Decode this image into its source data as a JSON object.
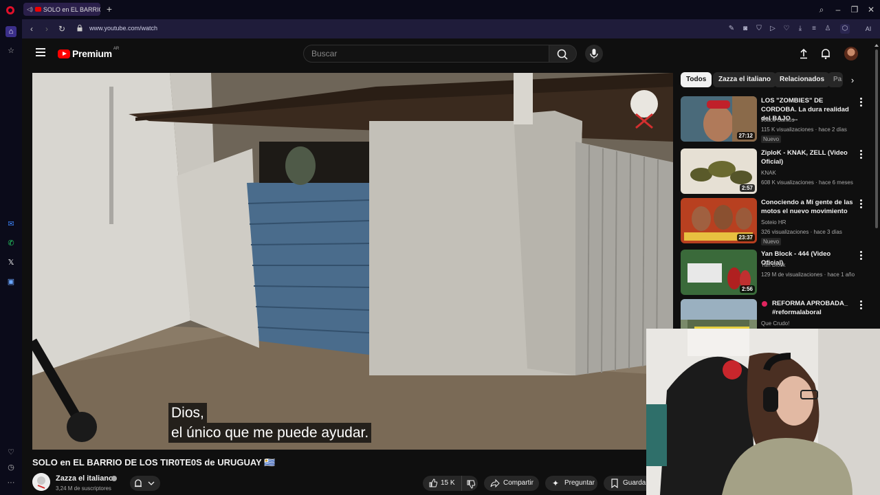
{
  "browser": {
    "tab_title": "SOLO en EL BARRIO D",
    "url": "www.youtube.com/watch",
    "ai_label": "AI"
  },
  "youtube": {
    "logo_text": "Premium",
    "country_code": "AR",
    "search_placeholder": "Buscar"
  },
  "video": {
    "caption_line1": "Dios,",
    "caption_line2": "el único que me puede ayudar.",
    "title": "SOLO en EL BARRIO DE LOS TIR0TE0S de URUGUAY 🇺🇾",
    "channel": "Zazza el italiano",
    "subscribers": "3,24 M de suscriptores",
    "likes": "15 K",
    "share_label": "Compartir",
    "ask_label": "Preguntar",
    "save_label": "Guardar"
  },
  "chips": [
    "Todos",
    "Zazza el italiano",
    "Relacionados",
    "Pa"
  ],
  "recommendations": [
    {
      "title": "LOS \"ZOMBIES\" DE CORDOBA. La dura realidad del BAJO ...",
      "channel": "Joaco Santos",
      "meta": "115 K visualizaciones · hace 2 días",
      "badge": "Nuevo",
      "duration": "27:12"
    },
    {
      "title": "ZiploK - KNAK, ZELL (Video Oficial)",
      "channel": "KNAK",
      "meta": "608 K visualizaciones · hace 6 meses",
      "badge": "",
      "duration": "2:57"
    },
    {
      "title": "Conociendo a Mí gente de las motos el nuevo movimiento",
      "channel": "Soteio HR",
      "meta": "326 visualizaciones · hace 3 días",
      "badge": "Nuevo",
      "duration": "23:37"
    },
    {
      "title": "Yan Block - 444 (Video Oficial)",
      "channel": "Yan Block",
      "meta": "129 M de visualizaciones · hace 1 año",
      "badge": "",
      "duration": "2:56"
    },
    {
      "title": "REFORMA APROBADA_ #reformalaboral",
      "channel": "Que Crudo!",
      "meta": "",
      "badge": "",
      "duration": ""
    }
  ],
  "colors": {
    "accent_red": "#ff0000",
    "browser_bg": "#0b0b1a",
    "addressbar_bg": "#1f1c3a",
    "page_bg": "#0f0f0f"
  }
}
